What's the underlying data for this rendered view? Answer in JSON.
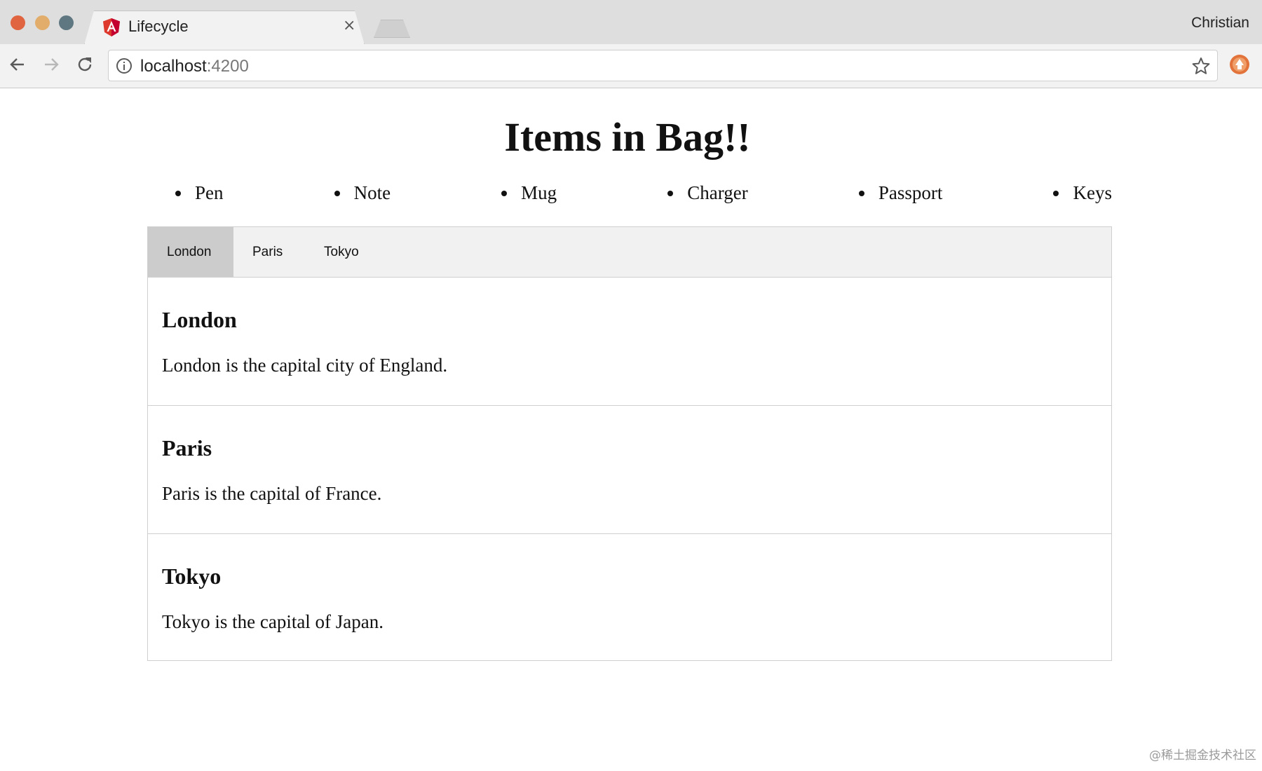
{
  "browser": {
    "tab_title": "Lifecycle",
    "tab_close": "×",
    "profile_name": "Christian",
    "url_host": "localhost",
    "url_port": ":4200"
  },
  "page": {
    "title": "Items in Bag!!",
    "bag_items": [
      "Pen",
      "Note",
      "Mug",
      "Charger",
      "Passport",
      "Keys"
    ],
    "tabs": [
      {
        "label": "London",
        "active": true
      },
      {
        "label": "Paris",
        "active": false
      },
      {
        "label": "Tokyo",
        "active": false
      }
    ],
    "panels": [
      {
        "heading": "London",
        "text": "London is the capital city of England."
      },
      {
        "heading": "Paris",
        "text": "Paris is the capital of France."
      },
      {
        "heading": "Tokyo",
        "text": "Tokyo is the capital of Japan."
      }
    ]
  },
  "watermark": "@稀土掘金技术社区",
  "colors": {
    "angular_red": "#dd3a2d",
    "active_tab": "#cccccc",
    "tab_strip": "#f1f1f1",
    "extension_orange": "#e2733b"
  }
}
